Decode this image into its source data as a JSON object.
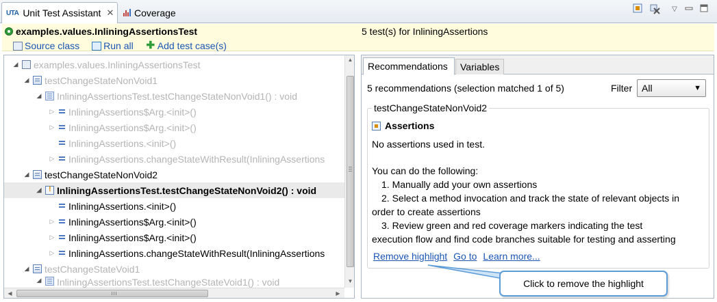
{
  "tabs": {
    "uta_logo": "UTA",
    "uta_label": "Unit Test Assistant",
    "close_glyph": "✕",
    "coverage_label": "Coverage"
  },
  "header": {
    "title": "examples.values.InliningAssertionsTest",
    "test_count": "5 test(s) for InliningAssertions",
    "links": {
      "source_class": "Source class",
      "run_all": "Run all",
      "add_test_case": "Add test case(s)"
    }
  },
  "tree": {
    "rows": [
      "examples.values.InliningAssertionsTest",
      "testChangeStateNonVoid1",
      "InliningAssertionsTest.testChangeStateNonVoid1() : void",
      "InliningAssertions$Arg.<init>()",
      "InliningAssertions$Arg.<init>()",
      "InliningAssertions.<init>()",
      "InliningAssertions.changeStateWithResult(InliningAssertions",
      "testChangeStateNonVoid2",
      "InliningAssertionsTest.testChangeStateNonVoid2() : void",
      "InliningAssertions.<init>()",
      "InliningAssertions$Arg.<init>()",
      "InliningAssertions$Arg.<init>()",
      "InliningAssertions.changeStateWithResult(InliningAssertions",
      "testChangeStateVoid1",
      "InliningAssertionsTest.testChangeStateVoid1() : void"
    ],
    "selected_index": 8
  },
  "details": {
    "tab_recommendations": "Recommendations",
    "tab_variables": "Variables",
    "summary": "5 recommendations (selection matched 1 of 5)",
    "filter_label": "Filter",
    "filter_value": "All",
    "group_title": "testChangeStateNonVoid2",
    "section_title": "Assertions",
    "no_assertions": "No assertions used in test.",
    "intro": "You can do the following:",
    "step1": "1. Manually add your own assertions",
    "step2a": "2. Select a method invocation and track the state of relevant objects in",
    "step2b": "order to create assertions",
    "step3a": "3. Review green and red coverage markers indicating the test",
    "step3b": "execution flow and find code branches suitable for testing and asserting",
    "links": {
      "remove_highlight": "Remove highlight",
      "go_to": "Go to",
      "learn_more": "Learn more..."
    }
  },
  "callout": {
    "text": "Click to remove the highlight"
  }
}
